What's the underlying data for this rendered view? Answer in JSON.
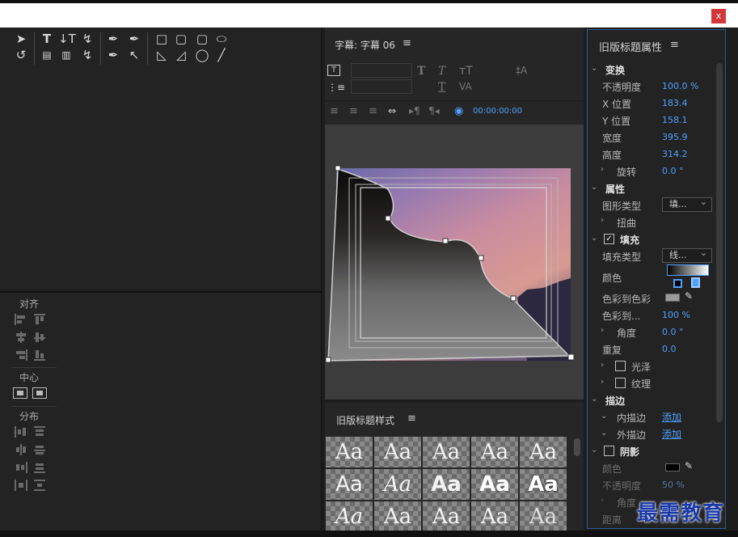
{
  "window": {
    "close_label": "x"
  },
  "subtitle_panel": {
    "title": "字幕: 字幕 06",
    "menu_icon": "hamburger-icon",
    "timecode": "00:00:00:00"
  },
  "actions": {
    "align_label": "对齐",
    "center_label": "中心",
    "distribute_label": "分布"
  },
  "styles_panel": {
    "title": "旧版标题样式",
    "sample": "Aa"
  },
  "props_panel": {
    "title": "旧版标题属性",
    "transform": {
      "label": "变换",
      "opacity_label": "不透明度",
      "opacity": "100.0 %",
      "x_label": "X 位置",
      "x": "183.4",
      "y_label": "Y 位置",
      "y": "158.1",
      "width_label": "宽度",
      "width": "395.9",
      "height_label": "高度",
      "height": "314.2",
      "rotation_label": "旋转",
      "rotation": "0.0 °"
    },
    "attributes": {
      "label": "属性",
      "shape_type_label": "图形类型",
      "shape_type": "填...",
      "distort_label": "扭曲"
    },
    "fill": {
      "label": "填充",
      "fill_type_label": "填充类型",
      "fill_type": "线...",
      "color_label": "颜色",
      "color_to_color_label": "色彩到色彩",
      "color_to_label": "色彩到...",
      "color_to_value": "100 %",
      "angle_label": "角度",
      "angle": "0.0 °",
      "repeat_label": "重复",
      "repeat": "0.0",
      "sheen_label": "光泽",
      "texture_label": "纹理"
    },
    "stroke": {
      "label": "描边",
      "inner_label": "内描边",
      "inner_add": "添加",
      "outer_label": "外描边",
      "outer_add": "添加"
    },
    "shadow": {
      "label": "阴影",
      "color_label": "颜色",
      "opacity_label": "不透明度",
      "opacity": "50 %",
      "angle_label": "角度",
      "distance_label": "距离"
    }
  },
  "watermark": "最需教育",
  "colors": {
    "accent": "#4ea1ff",
    "panel_border": "#2b5c96",
    "close": "#d2373a"
  }
}
